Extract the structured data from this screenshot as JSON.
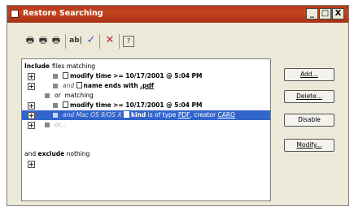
{
  "window": {
    "title": "Restore Searching",
    "controls": [
      "_",
      "□",
      "X"
    ]
  },
  "toolbar": {
    "icons": [
      "printer-icon",
      "printer-icon",
      "printer-icon",
      "text-field-icon",
      "checkmark-icon",
      "delete-x-icon",
      "help-icon"
    ]
  },
  "criteria": {
    "include_prefix": "Include",
    "include_suffix": "files matching",
    "row2_field": "modify time",
    "row2_op": ">= 10/17/2001 @ 5:04 PM",
    "row3_conj": "and",
    "row3_text": "name ends with",
    "row3_value": ".pdf",
    "row4_conj": "or",
    "row4_text": "matching",
    "row5_field": "modify time",
    "row5_op": ">= 10/17/2001 @ 5:04 PM",
    "row6_prefix": "and Mac OS 9/OS X",
    "row6_kind": "kind",
    "row6_is": "is of type",
    "row6_type": "PDF",
    "row6_creator": ", creator",
    "row6_creator_value": "CARO",
    "row7_conj": "or...",
    "exclude_prefix": "and",
    "exclude_word": "exclude",
    "exclude_suffix": "nothing"
  },
  "buttons": {
    "add": "Add...",
    "delete": "Delete...",
    "disable": "Disable",
    "modify": "Modify..."
  }
}
